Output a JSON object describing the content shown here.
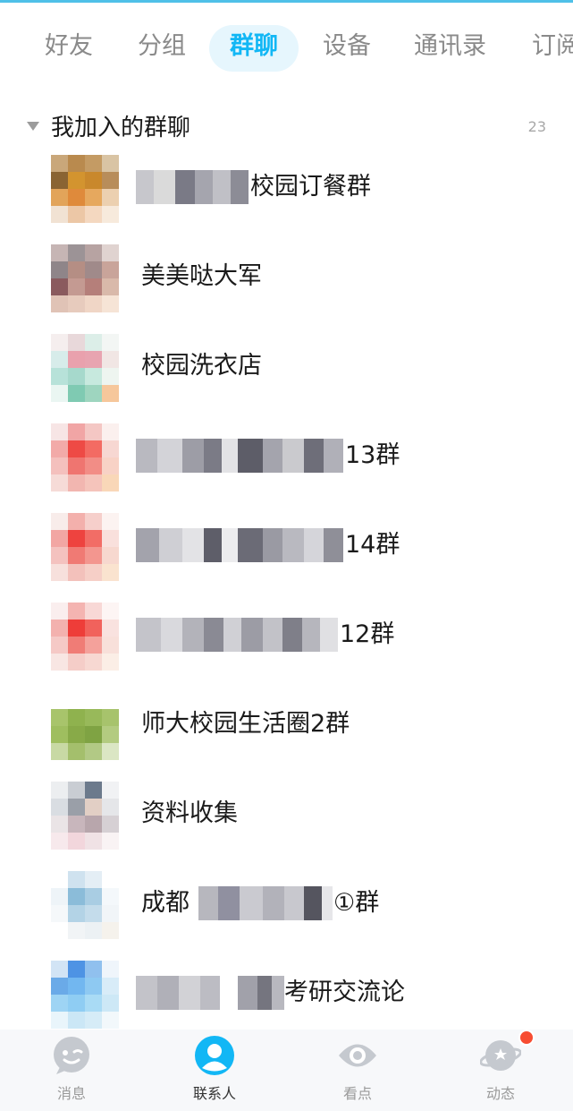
{
  "tabs": [
    {
      "label": "好友"
    },
    {
      "label": "分组"
    },
    {
      "label": "群聊"
    },
    {
      "label": "设备"
    },
    {
      "label": "通讯录"
    },
    {
      "label": "订阅"
    }
  ],
  "active_tab": "群聊",
  "section": {
    "title": "我加入的群聊",
    "count": "23"
  },
  "groups": [
    {
      "name_visible": "校园订餐群",
      "redacted": true
    },
    {
      "name_visible": "美美哒大军",
      "redacted": false
    },
    {
      "name_visible": "校园洗衣店",
      "redacted": false
    },
    {
      "name_visible": "13群",
      "redacted": true
    },
    {
      "name_visible": "14群",
      "redacted": true
    },
    {
      "name_visible": "12群",
      "redacted": true
    },
    {
      "name_visible": "师大校园生活圈2群",
      "redacted": false
    },
    {
      "name_visible": "资料收集",
      "redacted": false
    },
    {
      "name_visible_prefix": "成都",
      "name_visible": "①群",
      "redacted": true
    },
    {
      "name_visible": "考研交流论",
      "redacted": true
    }
  ],
  "bottom_nav": [
    {
      "label": "消息",
      "icon": "message-icon"
    },
    {
      "label": "联系人",
      "icon": "contacts-icon"
    },
    {
      "label": "看点",
      "icon": "eye-icon"
    },
    {
      "label": "动态",
      "icon": "planet-icon"
    }
  ],
  "colors": {
    "accent": "#12b7f5",
    "badge": "#f74c31",
    "text": "#1a1a1a",
    "muted": "#8a8a8a"
  }
}
